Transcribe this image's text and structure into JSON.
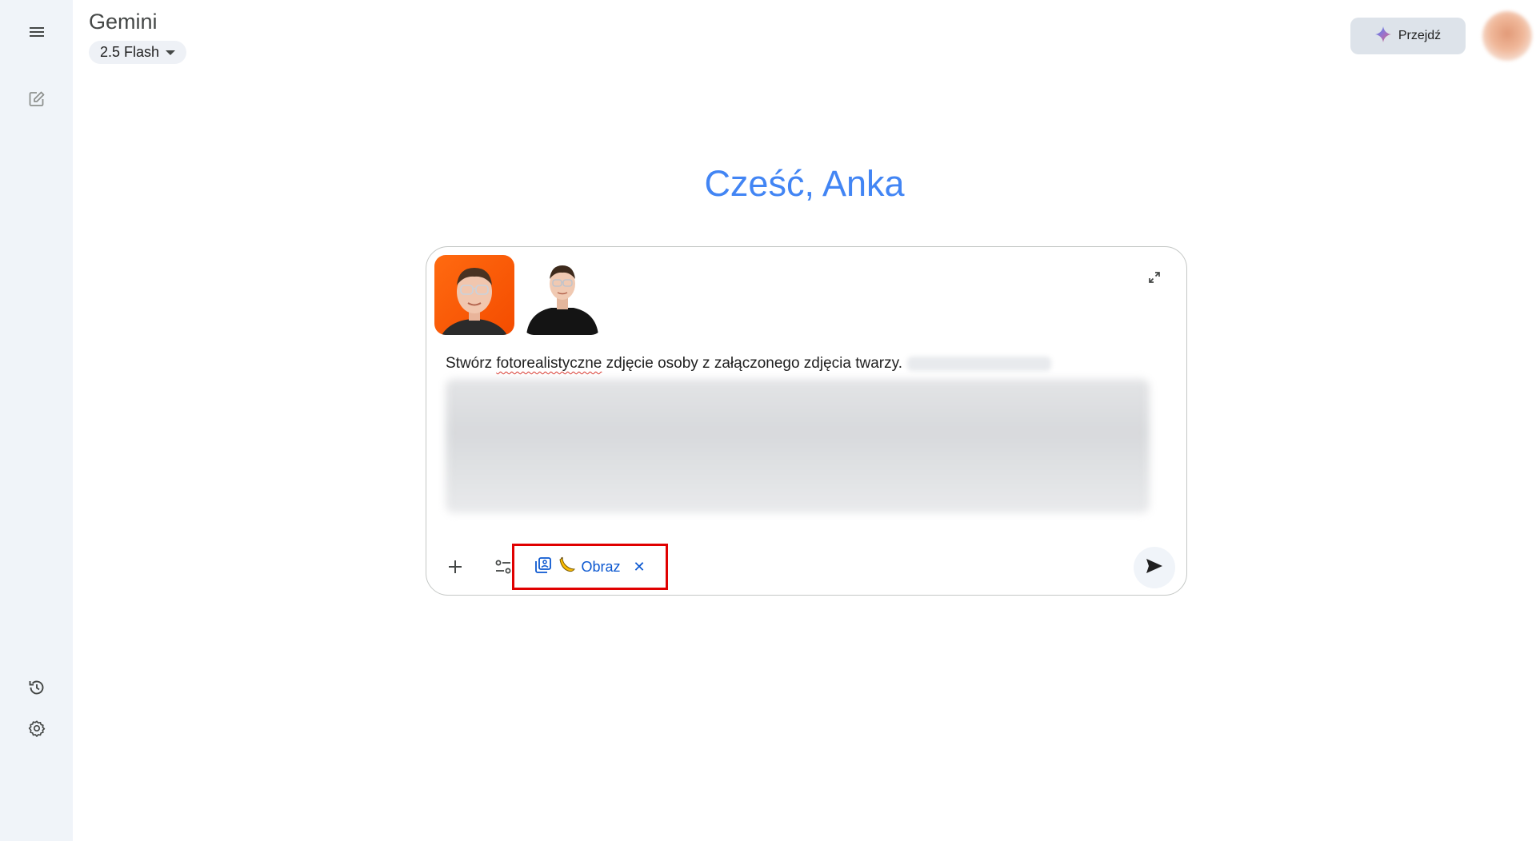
{
  "app": {
    "title": "Gemini",
    "model_label": "2.5 Flash"
  },
  "header": {
    "upgrade_label": "Przejdź"
  },
  "greeting": "Cześć, Anka",
  "prompt": {
    "text_before": "Stwórz ",
    "text_misspelled": "fotorealistyczne",
    "text_after": " zdjęcie osoby z załączonego zdjęcia twarzy."
  },
  "tool_chip": {
    "label": "Obraz",
    "close_glyph": "✕"
  },
  "icons": {
    "sidebar": [
      "menu-icon",
      "new-chat-icon",
      "history-icon",
      "settings-icon"
    ],
    "toolbar": [
      "plus-icon",
      "tools-icon",
      "image-gallery-icon",
      "banana-icon",
      "close-icon",
      "send-icon",
      "expand-icon"
    ]
  },
  "colors": {
    "greeting": "#4285f4",
    "chip_text": "#0b57d0",
    "highlight_box": "#e00000",
    "sidebar_bg": "#f0f4f9",
    "thumb_bg": "#f44c00"
  }
}
